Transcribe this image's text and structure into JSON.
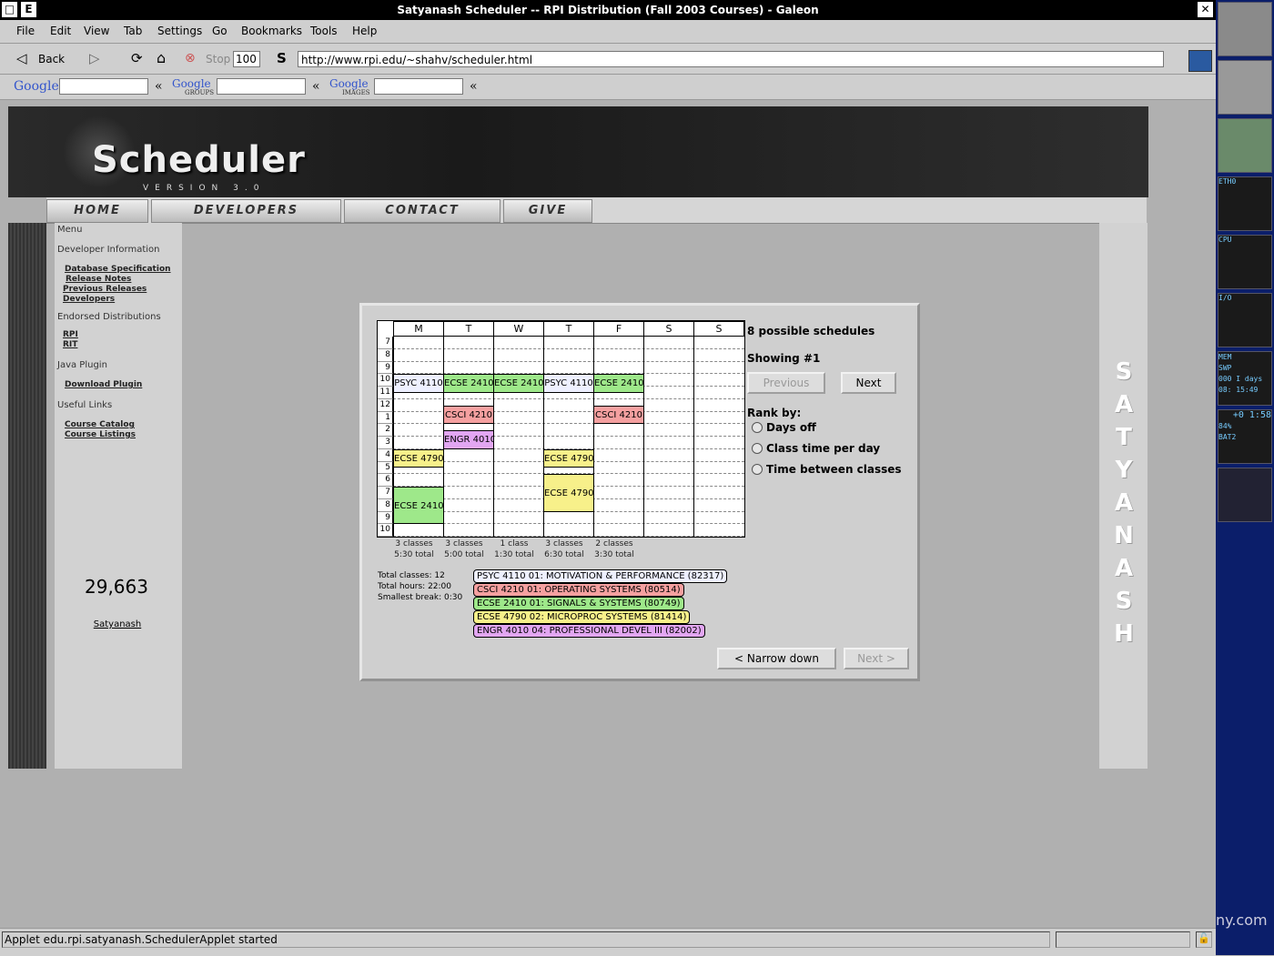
{
  "window": {
    "title": "Satyanash Scheduler -- RPI Distribution (Fall 2003 Courses) - Galeon"
  },
  "menu": [
    "File",
    "Edit",
    "View",
    "Tab",
    "Settings",
    "Go",
    "Bookmarks",
    "Tools",
    "Help"
  ],
  "nav": {
    "back": "Back",
    "stop": "Stop",
    "zoom": "100",
    "url": "http://www.rpi.edu/~shahv/scheduler.html"
  },
  "google": {
    "logo1": "Google",
    "logo2": "Google",
    "logo2_sub": "GROUPS",
    "logo3": "Google",
    "logo3_sub": "IMAGES",
    "chev": "«"
  },
  "site": {
    "logo": "Scheduler",
    "version": "VERSION 3.0",
    "tabs": [
      "HOME",
      "DEVELOPERS",
      "CONTACT",
      "GIVE"
    ],
    "sidebar": {
      "menu": "Menu",
      "dev_heading": "Developer Information",
      "dev_links": [
        "Database Specification",
        "Release Notes",
        "Previous Releases",
        "Developers"
      ],
      "dist_heading": "Endorsed Distributions",
      "dist_links": [
        "RPI",
        "RIT"
      ],
      "java_heading": "Java Plugin",
      "java_links": [
        "Download Plugin"
      ],
      "useful_heading": "Useful Links",
      "useful_links": [
        "Course Catalog",
        "Course Listings"
      ],
      "counter": "29,663",
      "counter_link": "Satyanash"
    },
    "vertical_text": "SATYANASH"
  },
  "applet": {
    "days": [
      "M",
      "T",
      "W",
      "T",
      "F",
      "S",
      "S"
    ],
    "hours": [
      "7",
      "8",
      "9",
      "10",
      "11",
      "12",
      "1",
      "2",
      "3",
      "4",
      "5",
      "6",
      "7",
      "8",
      "9",
      "10"
    ],
    "blocks": [
      {
        "label": "PSYC 4110",
        "color": "#eef0ff"
      },
      {
        "label": "ECSE 2410",
        "color": "#9ee88a"
      },
      {
        "label": "ECSE 2410",
        "color": "#9ee88a"
      },
      {
        "label": "PSYC 4110",
        "color": "#eef0ff"
      },
      {
        "label": "ECSE 2410",
        "color": "#9ee88a"
      },
      {
        "label": "CSCI 4210",
        "color": "#f5a0a0"
      },
      {
        "label": "CSCI 4210",
        "color": "#f5a0a0"
      },
      {
        "label": "ENGR 4010",
        "color": "#e2a6f2"
      },
      {
        "label": "ECSE 4790",
        "color": "#f7f08a"
      },
      {
        "label": "ECSE 4790",
        "color": "#f7f08a"
      },
      {
        "label": "ECSE 4790",
        "color": "#f7f08a"
      },
      {
        "label": "ECSE 2410",
        "color": "#9ee88a"
      }
    ],
    "day_stats": [
      {
        "classes": "3 classes",
        "total": "5:30 total"
      },
      {
        "classes": "3 classes",
        "total": "5:00 total"
      },
      {
        "classes": "1 class",
        "total": "1:30 total"
      },
      {
        "classes": "3 classes",
        "total": "6:30 total"
      },
      {
        "classes": "2 classes",
        "total": "3:30 total"
      }
    ],
    "possible": "8 possible schedules",
    "showing": "Showing #1",
    "previous": "Previous",
    "next": "Next",
    "rank_by": "Rank by:",
    "rank_options": [
      "Days off",
      "Class time per day",
      "Time between classes"
    ],
    "totals": [
      "Total classes: 12",
      "Total hours: 22:00",
      "Smallest break: 0:30"
    ],
    "legend": [
      {
        "label": "PSYC 4110 01: MOTIVATION & PERFORMANCE (82317)",
        "color": "#eef0ff"
      },
      {
        "label": "CSCI 4210 01: OPERATING SYSTEMS (80514)",
        "color": "#f5a0a0"
      },
      {
        "label": "ECSE 2410 01: SIGNALS & SYSTEMS (80749)",
        "color": "#9ee88a"
      },
      {
        "label": "ECSE 4790 02: MICROPROC SYSTEMS (81414)",
        "color": "#f7f08a"
      },
      {
        "label": "ENGR 4010 04: PROFESSIONAL DEVEL III (82002)",
        "color": "#e2a6f2"
      }
    ],
    "narrow_down": "< Narrow down",
    "next_step": "Next >"
  },
  "status": "Applet edu.rpi.satyanash.SchedulerApplet started",
  "dock": {
    "eth": "ETH0",
    "cpu": "CPU",
    "io": "I/O",
    "mem": "MEM",
    "swp": "SWP",
    "uptime": "000 I days",
    "time1": "08: 15:49",
    "clock": "+0 1:58",
    "bat_pct": "84%",
    "bat": "BAT2",
    "desktop_text": "ny.com"
  }
}
